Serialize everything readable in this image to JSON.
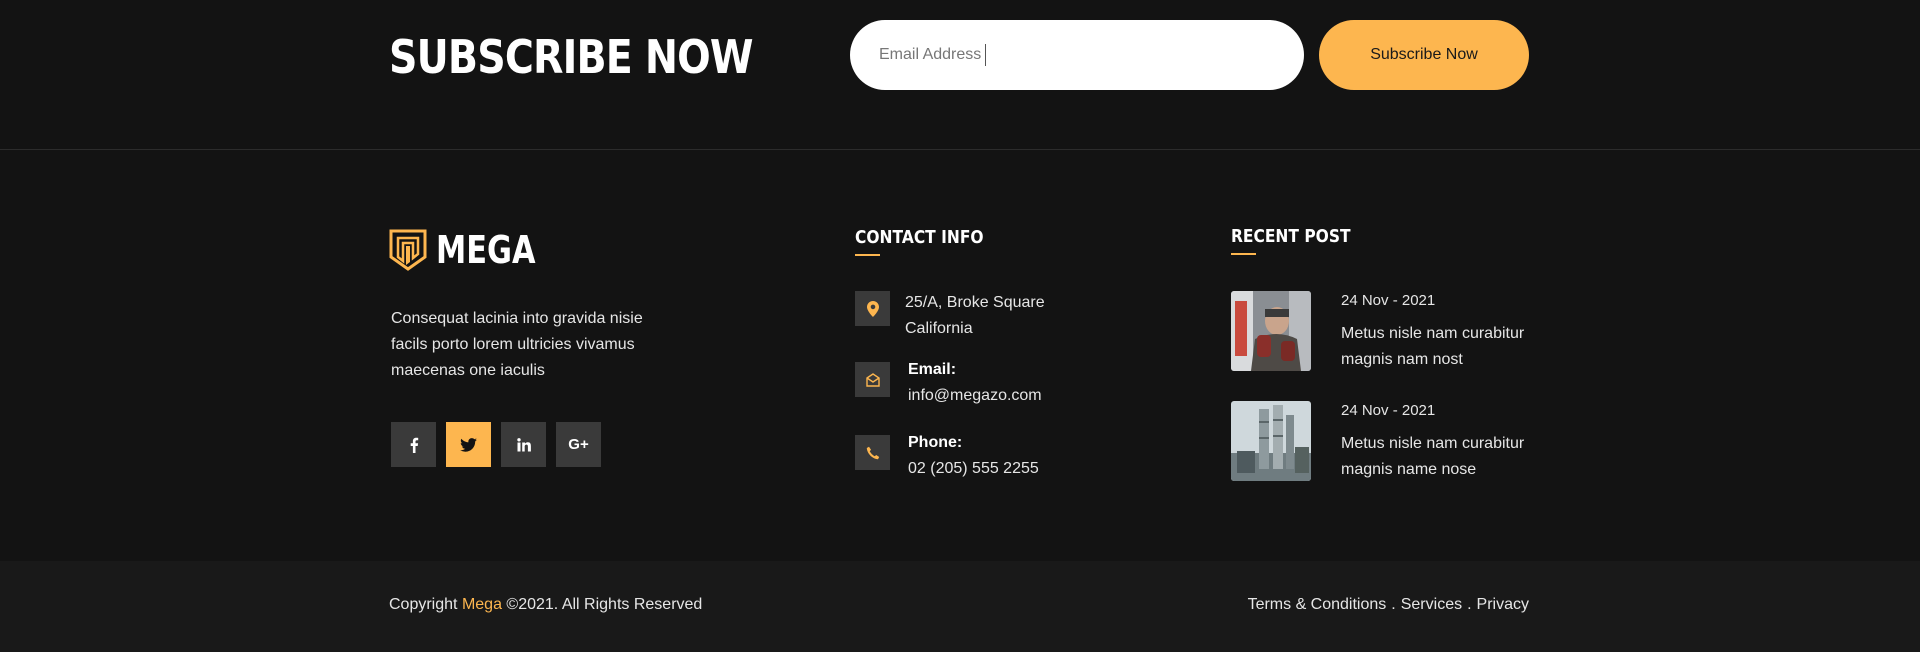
{
  "subscribe": {
    "title": "SUBSCRIBE NOW",
    "email_placeholder": "Email Address",
    "button_label": "Subscribe Now"
  },
  "brand": {
    "name": "MEGA",
    "about": "Consequat lacinia into gravida nisie facils porto lorem ultricies vivamus maecenas one iaculis",
    "logo_icon": "shield-logo-icon"
  },
  "socials": [
    {
      "name": "facebook",
      "glyph": "f",
      "active": false
    },
    {
      "name": "twitter",
      "glyph": "t",
      "active": true
    },
    {
      "name": "linkedin",
      "glyph": "in",
      "active": false
    },
    {
      "name": "google-plus",
      "glyph": "G+",
      "active": false
    }
  ],
  "contact": {
    "title": "CONTACT INFO",
    "address_line1": "25/A, Broke Square",
    "address_line2": "California",
    "email_label": "Email:",
    "email_value": "info@megazo.com",
    "phone_label": "Phone:",
    "phone_value": "02 (205) 555 2255"
  },
  "recent": {
    "title": "RECENT POST",
    "posts": [
      {
        "date": "24 Nov - 2021",
        "title": "Metus nisle nam curabitur magnis nam nost"
      },
      {
        "date": "24 Nov - 2021",
        "title": "Metus nisle nam curabitur magnis name nose"
      }
    ]
  },
  "footer": {
    "copyright_prefix": "Copyright",
    "copyright_brand": "Mega",
    "copyright_suffix": "©2021. All Rights Reserved",
    "links": [
      "Terms & Conditions",
      "Services",
      "Privacy"
    ],
    "separator": "."
  },
  "colors": {
    "background": "#131313",
    "accent": "#fdb64f",
    "tile": "#3a3a3a",
    "bottom_bar": "#191919"
  }
}
